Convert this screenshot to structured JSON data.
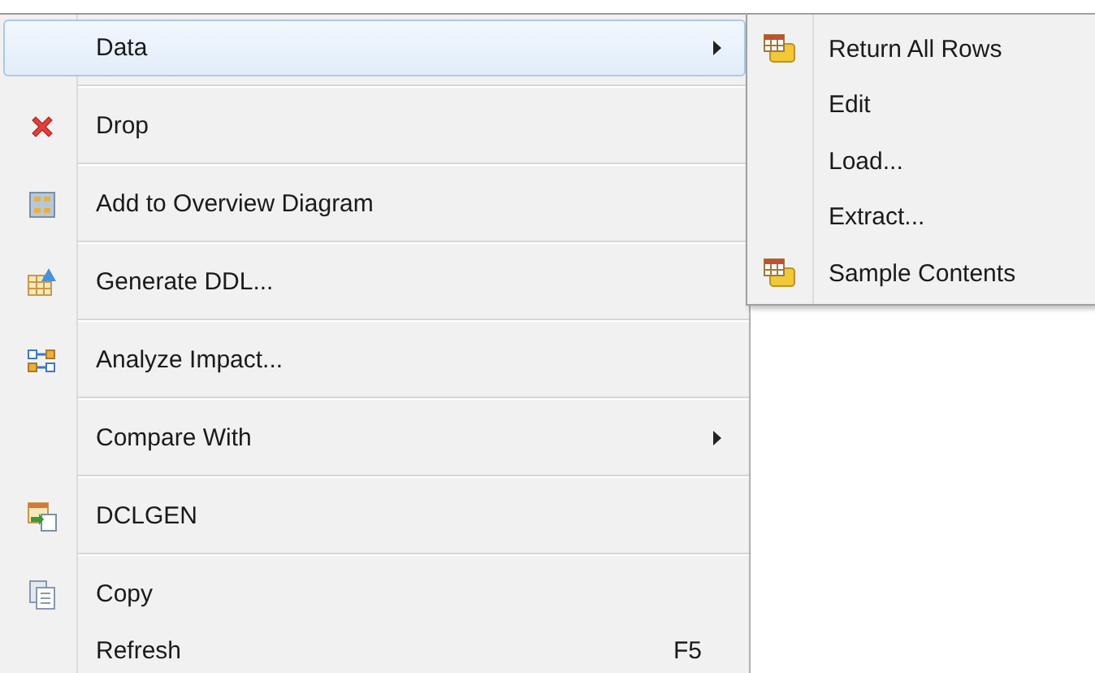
{
  "menu": {
    "items": [
      {
        "label": "Data",
        "kind": "none",
        "selected": true,
        "submenu": true,
        "separator_after": true
      },
      {
        "label": "Drop",
        "kind": "drop",
        "selected": false,
        "submenu": false,
        "separator_after": true
      },
      {
        "label": "Add to Overview Diagram",
        "kind": "diagram",
        "selected": false,
        "submenu": false,
        "separator_after": true
      },
      {
        "label": "Generate DDL...",
        "kind": "ddl",
        "selected": false,
        "submenu": false,
        "separator_after": true
      },
      {
        "label": "Analyze Impact...",
        "kind": "analyze",
        "selected": false,
        "submenu": false,
        "separator_after": true
      },
      {
        "label": "Compare With",
        "kind": "none",
        "selected": false,
        "submenu": true,
        "separator_after": true
      },
      {
        "label": "DCLGEN",
        "kind": "dclgen",
        "selected": false,
        "submenu": false,
        "separator_after": true
      },
      {
        "label": "Copy",
        "kind": "copy",
        "selected": false,
        "submenu": false,
        "separator_after": false
      },
      {
        "label": "Refresh",
        "kind": "none",
        "selected": false,
        "submenu": false,
        "separator_after": false,
        "shortcut": "F5"
      }
    ]
  },
  "submenu": {
    "items": [
      {
        "label": "Return All Rows",
        "kind": "table"
      },
      {
        "label": "Edit",
        "kind": "none"
      },
      {
        "label": "Load...",
        "kind": "none"
      },
      {
        "label": "Extract...",
        "kind": "none"
      },
      {
        "label": "Sample Contents",
        "kind": "table"
      }
    ]
  }
}
